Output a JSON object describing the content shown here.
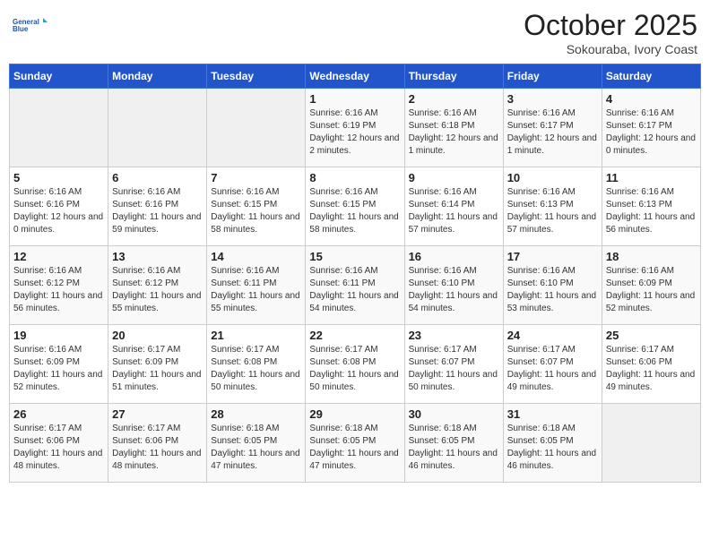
{
  "logo": {
    "line1": "General",
    "line2": "Blue"
  },
  "title": "October 2025",
  "subtitle": "Sokouraba, Ivory Coast",
  "days_of_week": [
    "Sunday",
    "Monday",
    "Tuesday",
    "Wednesday",
    "Thursday",
    "Friday",
    "Saturday"
  ],
  "weeks": [
    [
      {
        "day": "",
        "info": ""
      },
      {
        "day": "",
        "info": ""
      },
      {
        "day": "",
        "info": ""
      },
      {
        "day": "1",
        "info": "Sunrise: 6:16 AM\nSunset: 6:19 PM\nDaylight: 12 hours and 2 minutes."
      },
      {
        "day": "2",
        "info": "Sunrise: 6:16 AM\nSunset: 6:18 PM\nDaylight: 12 hours and 1 minute."
      },
      {
        "day": "3",
        "info": "Sunrise: 6:16 AM\nSunset: 6:17 PM\nDaylight: 12 hours and 1 minute."
      },
      {
        "day": "4",
        "info": "Sunrise: 6:16 AM\nSunset: 6:17 PM\nDaylight: 12 hours and 0 minutes."
      }
    ],
    [
      {
        "day": "5",
        "info": "Sunrise: 6:16 AM\nSunset: 6:16 PM\nDaylight: 12 hours and 0 minutes."
      },
      {
        "day": "6",
        "info": "Sunrise: 6:16 AM\nSunset: 6:16 PM\nDaylight: 11 hours and 59 minutes."
      },
      {
        "day": "7",
        "info": "Sunrise: 6:16 AM\nSunset: 6:15 PM\nDaylight: 11 hours and 58 minutes."
      },
      {
        "day": "8",
        "info": "Sunrise: 6:16 AM\nSunset: 6:15 PM\nDaylight: 11 hours and 58 minutes."
      },
      {
        "day": "9",
        "info": "Sunrise: 6:16 AM\nSunset: 6:14 PM\nDaylight: 11 hours and 57 minutes."
      },
      {
        "day": "10",
        "info": "Sunrise: 6:16 AM\nSunset: 6:13 PM\nDaylight: 11 hours and 57 minutes."
      },
      {
        "day": "11",
        "info": "Sunrise: 6:16 AM\nSunset: 6:13 PM\nDaylight: 11 hours and 56 minutes."
      }
    ],
    [
      {
        "day": "12",
        "info": "Sunrise: 6:16 AM\nSunset: 6:12 PM\nDaylight: 11 hours and 56 minutes."
      },
      {
        "day": "13",
        "info": "Sunrise: 6:16 AM\nSunset: 6:12 PM\nDaylight: 11 hours and 55 minutes."
      },
      {
        "day": "14",
        "info": "Sunrise: 6:16 AM\nSunset: 6:11 PM\nDaylight: 11 hours and 55 minutes."
      },
      {
        "day": "15",
        "info": "Sunrise: 6:16 AM\nSunset: 6:11 PM\nDaylight: 11 hours and 54 minutes."
      },
      {
        "day": "16",
        "info": "Sunrise: 6:16 AM\nSunset: 6:10 PM\nDaylight: 11 hours and 54 minutes."
      },
      {
        "day": "17",
        "info": "Sunrise: 6:16 AM\nSunset: 6:10 PM\nDaylight: 11 hours and 53 minutes."
      },
      {
        "day": "18",
        "info": "Sunrise: 6:16 AM\nSunset: 6:09 PM\nDaylight: 11 hours and 52 minutes."
      }
    ],
    [
      {
        "day": "19",
        "info": "Sunrise: 6:16 AM\nSunset: 6:09 PM\nDaylight: 11 hours and 52 minutes."
      },
      {
        "day": "20",
        "info": "Sunrise: 6:17 AM\nSunset: 6:09 PM\nDaylight: 11 hours and 51 minutes."
      },
      {
        "day": "21",
        "info": "Sunrise: 6:17 AM\nSunset: 6:08 PM\nDaylight: 11 hours and 50 minutes."
      },
      {
        "day": "22",
        "info": "Sunrise: 6:17 AM\nSunset: 6:08 PM\nDaylight: 11 hours and 50 minutes."
      },
      {
        "day": "23",
        "info": "Sunrise: 6:17 AM\nSunset: 6:07 PM\nDaylight: 11 hours and 50 minutes."
      },
      {
        "day": "24",
        "info": "Sunrise: 6:17 AM\nSunset: 6:07 PM\nDaylight: 11 hours and 49 minutes."
      },
      {
        "day": "25",
        "info": "Sunrise: 6:17 AM\nSunset: 6:06 PM\nDaylight: 11 hours and 49 minutes."
      }
    ],
    [
      {
        "day": "26",
        "info": "Sunrise: 6:17 AM\nSunset: 6:06 PM\nDaylight: 11 hours and 48 minutes."
      },
      {
        "day": "27",
        "info": "Sunrise: 6:17 AM\nSunset: 6:06 PM\nDaylight: 11 hours and 48 minutes."
      },
      {
        "day": "28",
        "info": "Sunrise: 6:18 AM\nSunset: 6:05 PM\nDaylight: 11 hours and 47 minutes."
      },
      {
        "day": "29",
        "info": "Sunrise: 6:18 AM\nSunset: 6:05 PM\nDaylight: 11 hours and 47 minutes."
      },
      {
        "day": "30",
        "info": "Sunrise: 6:18 AM\nSunset: 6:05 PM\nDaylight: 11 hours and 46 minutes."
      },
      {
        "day": "31",
        "info": "Sunrise: 6:18 AM\nSunset: 6:05 PM\nDaylight: 11 hours and 46 minutes."
      },
      {
        "day": "",
        "info": ""
      }
    ]
  ]
}
